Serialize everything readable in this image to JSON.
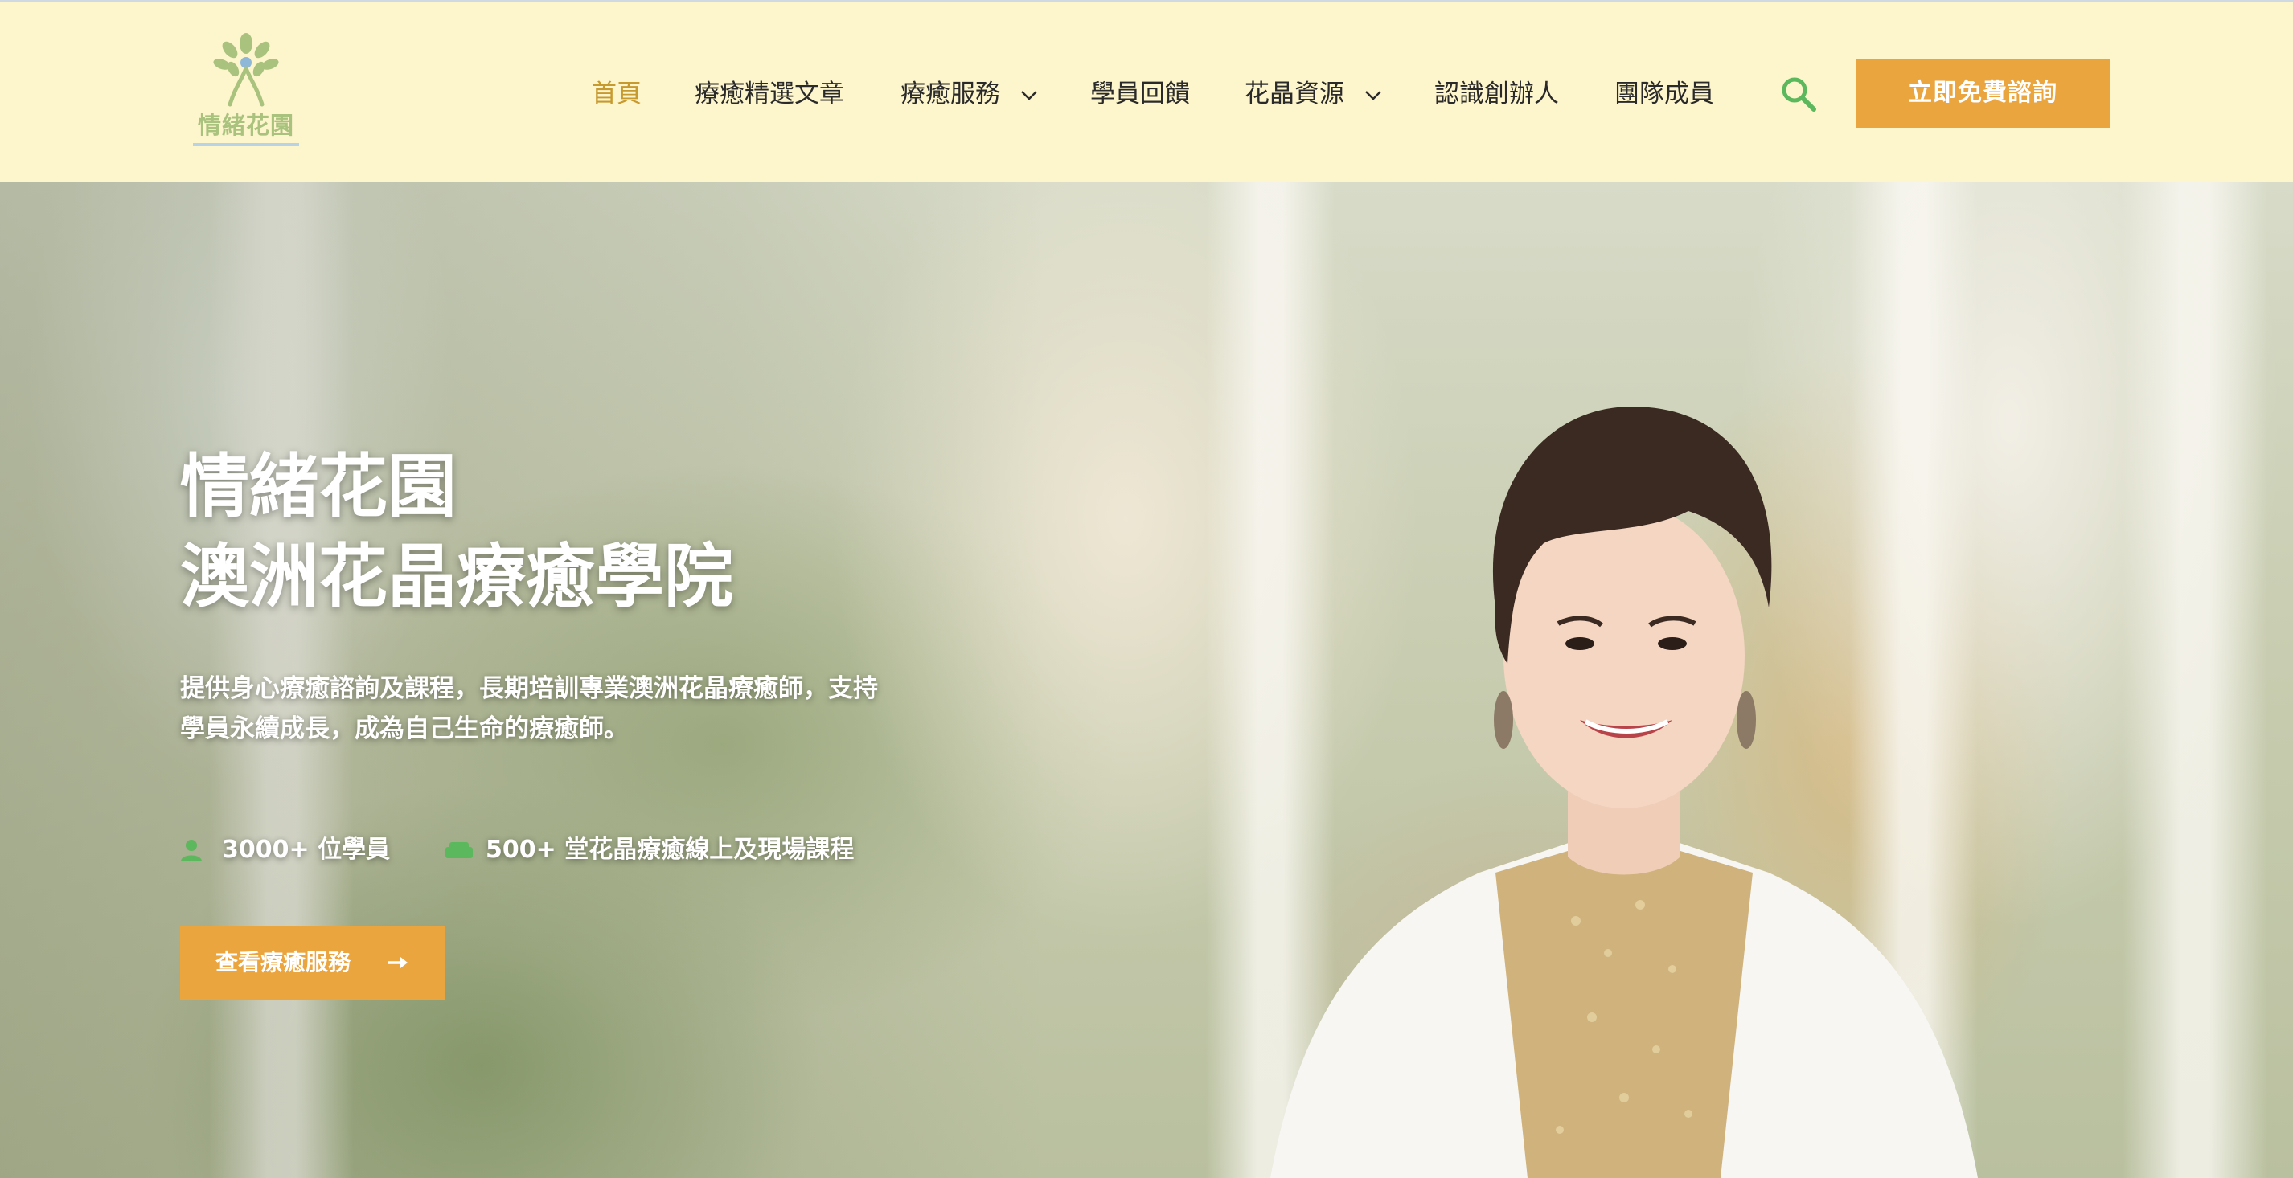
{
  "logo": {
    "text": "情緒花園",
    "icon": "tree-person-logo-icon",
    "colors": {
      "leaf": "#a9c27d",
      "accent": "#8fb8d8"
    }
  },
  "nav": {
    "items": [
      {
        "label": "首頁",
        "active": true
      },
      {
        "label": "療癒精選文章",
        "active": false
      },
      {
        "label": "療癒服務",
        "active": false,
        "dropdown": true
      },
      {
        "label": "學員回饋",
        "active": false
      },
      {
        "label": "花晶資源",
        "active": false,
        "dropdown": true
      },
      {
        "label": "認識創辦人",
        "active": false
      },
      {
        "label": "團隊成員",
        "active": false
      }
    ],
    "search_icon": "search-icon",
    "cta_label": "立即免費諮詢"
  },
  "hero": {
    "title_line1": "情緒花園",
    "title_line2": "澳洲花晶療癒學院",
    "description_line1": "提供身心療癒諮詢及課程，長期培訓專業澳洲花晶療癒師，支持",
    "description_line2": "學員永續成長，成為自己生命的療癒師。",
    "stats": [
      {
        "icon": "user-icon",
        "label": "3000+ 位學員"
      },
      {
        "icon": "sofa-icon",
        "label": "500+ 堂花晶療癒線上及現場課程"
      }
    ],
    "button_label": "查看療癒服務",
    "button_icon": "arrow-right-icon"
  },
  "colors": {
    "header_bg": "#fdf5cc",
    "accent_orange": "#eba53f",
    "nav_active": "#c79a2f",
    "icon_green": "#5cb85c"
  }
}
